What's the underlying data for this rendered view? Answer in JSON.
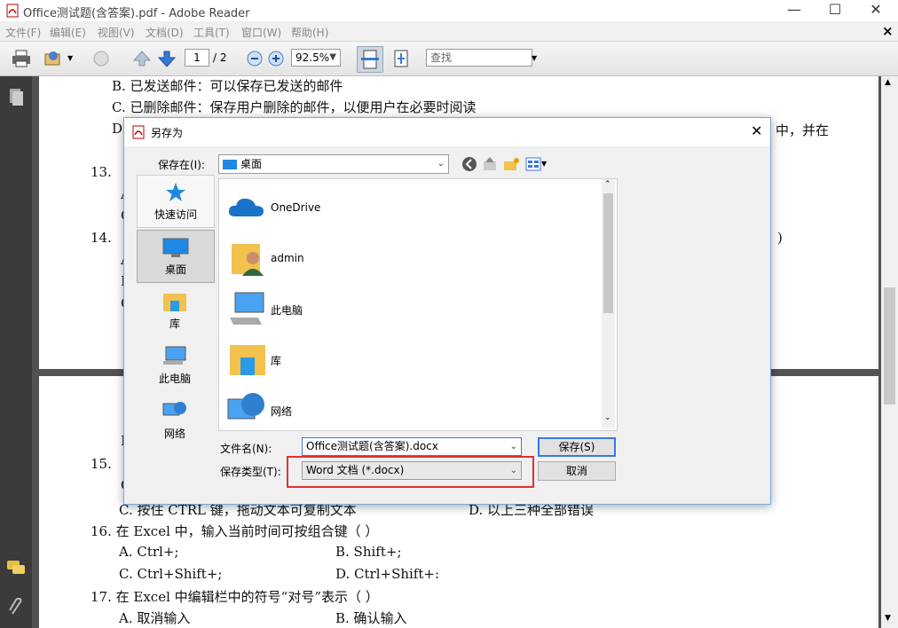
{
  "app": {
    "title": "Office测试题(含答案).pdf - Adobe Reader",
    "window_controls": {
      "minimize": "—",
      "maximize": "☐",
      "close": "✕"
    },
    "menu": [
      "文件(F)",
      "编辑(E)",
      "视图(V)",
      "文档(D)",
      "工具(T)",
      "窗口(W)",
      "帮助(H)"
    ],
    "menu_close": "×"
  },
  "toolbar": {
    "page_current": "1",
    "page_total": "/ 2",
    "zoom": "92.5%",
    "search_placeholder": "查找"
  },
  "document": {
    "lines_page1": [
      "B.  已发送邮件：可以保存已发送的邮件",
      "C.  已删除邮件：保存用户删除的邮件，以便用户在必要时阅读",
      "D.",
      "中，并在",
      "13.",
      "14.",
      ")"
    ],
    "lines_page2": [
      "15.",
      "C.  按住   CTRL   键，拖动文本可复制文本",
      "D.  以上三种全部错误",
      "16.  在 Excel 中，输入当前时间可按组合键（        ）",
      "A.  Ctrl+;",
      "B.  Shift+;",
      "C.  Ctrl+Shift+;",
      "D.  Ctrl+Shift+:",
      "17.  在 Excel 中编辑栏中的符号“对号”表示（        ）",
      "A.  取消输入",
      "B.  确认输入"
    ],
    "fragments": {
      "i": "I",
      "a": "A",
      "f": "F",
      "c": "C",
      "c2": "C",
      "a2": "A",
      "c3": "C"
    }
  },
  "dialog": {
    "title": "另存为",
    "close": "✕",
    "save_in_label": "保存在(I):",
    "save_in_value": "桌面",
    "places": [
      {
        "label": "快速访问",
        "icon": "star-icon"
      },
      {
        "label": "桌面",
        "icon": "desktop-icon"
      },
      {
        "label": "库",
        "icon": "library-icon"
      },
      {
        "label": "此电脑",
        "icon": "computer-icon"
      },
      {
        "label": "网络",
        "icon": "network-icon"
      }
    ],
    "files": [
      {
        "name": "OneDrive",
        "icon": "cloud-icon"
      },
      {
        "name": "admin",
        "icon": "user-folder-icon"
      },
      {
        "name": "此电脑",
        "icon": "computer-icon"
      },
      {
        "name": "库",
        "icon": "library-icon"
      },
      {
        "name": "网络",
        "icon": "network-icon"
      }
    ],
    "filename_label": "文件名(N):",
    "filename_value": "Office测试题(含答案).docx",
    "filetype_label": "保存类型(T):",
    "filetype_value": "Word 文档 (*.docx)",
    "save_button": "保存(S)",
    "cancel_button": "取消",
    "highlight_color": "#e03030"
  }
}
